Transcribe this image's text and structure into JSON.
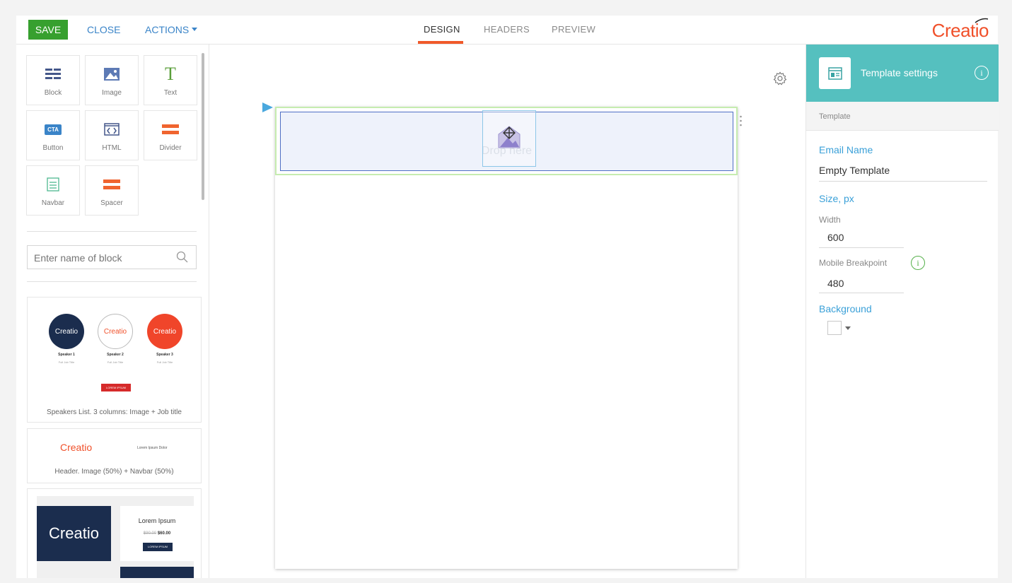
{
  "toolbar": {
    "save_label": "SAVE",
    "close_label": "CLOSE",
    "actions_label": "ACTIONS"
  },
  "tabs": [
    {
      "label": "DESIGN",
      "active": true
    },
    {
      "label": "HEADERS",
      "active": false
    },
    {
      "label": "PREVIEW",
      "active": false
    }
  ],
  "brand": {
    "logo_text": "Creatio",
    "color": "#f0502a"
  },
  "blocks": [
    {
      "label": "Block",
      "icon": "block-icon"
    },
    {
      "label": "Image",
      "icon": "image-icon"
    },
    {
      "label": "Text",
      "icon": "text-icon"
    },
    {
      "label": "Button",
      "icon": "cta-button-icon",
      "icon_text": "CTA"
    },
    {
      "label": "HTML",
      "icon": "html-icon"
    },
    {
      "label": "Divider",
      "icon": "divider-icon"
    },
    {
      "label": "Navbar",
      "icon": "navbar-icon"
    },
    {
      "label": "Spacer",
      "icon": "spacer-icon"
    }
  ],
  "search": {
    "placeholder": "Enter name of block"
  },
  "templates": [
    {
      "caption": "Speakers List. 3 columns: Image + Job title",
      "speakers": [
        {
          "name": "Speaker 1",
          "job": "Full Job Title",
          "logo": "Creatio"
        },
        {
          "name": "Speaker 2",
          "job": "Full Job Title",
          "logo": "Creatio"
        },
        {
          "name": "Speaker 3",
          "job": "Full Job Title",
          "logo": "Creatio"
        }
      ],
      "button": "LOREM IPSUM"
    },
    {
      "caption": "Header. Image (50%) + Navbar (50%)",
      "logo": "Creatio",
      "nav": "Lorem Ipsum Dolor"
    },
    {
      "logo": "Creatio",
      "title": "Lorem Ipsum",
      "old_price": "$90.00",
      "new_price": "$60.00",
      "button": "LOREM IPSUM"
    }
  ],
  "canvas": {
    "drop_text": "Drop here"
  },
  "settings": {
    "title": "Template settings",
    "section": "Template",
    "email_name_label": "Email Name",
    "email_name_value": "Empty Template",
    "size_label": "Size, px",
    "width_label": "Width",
    "width_value": "600",
    "breakpoint_label": "Mobile Breakpoint",
    "breakpoint_value": "480",
    "background_label": "Background",
    "accent_color": "#55c0bf"
  }
}
